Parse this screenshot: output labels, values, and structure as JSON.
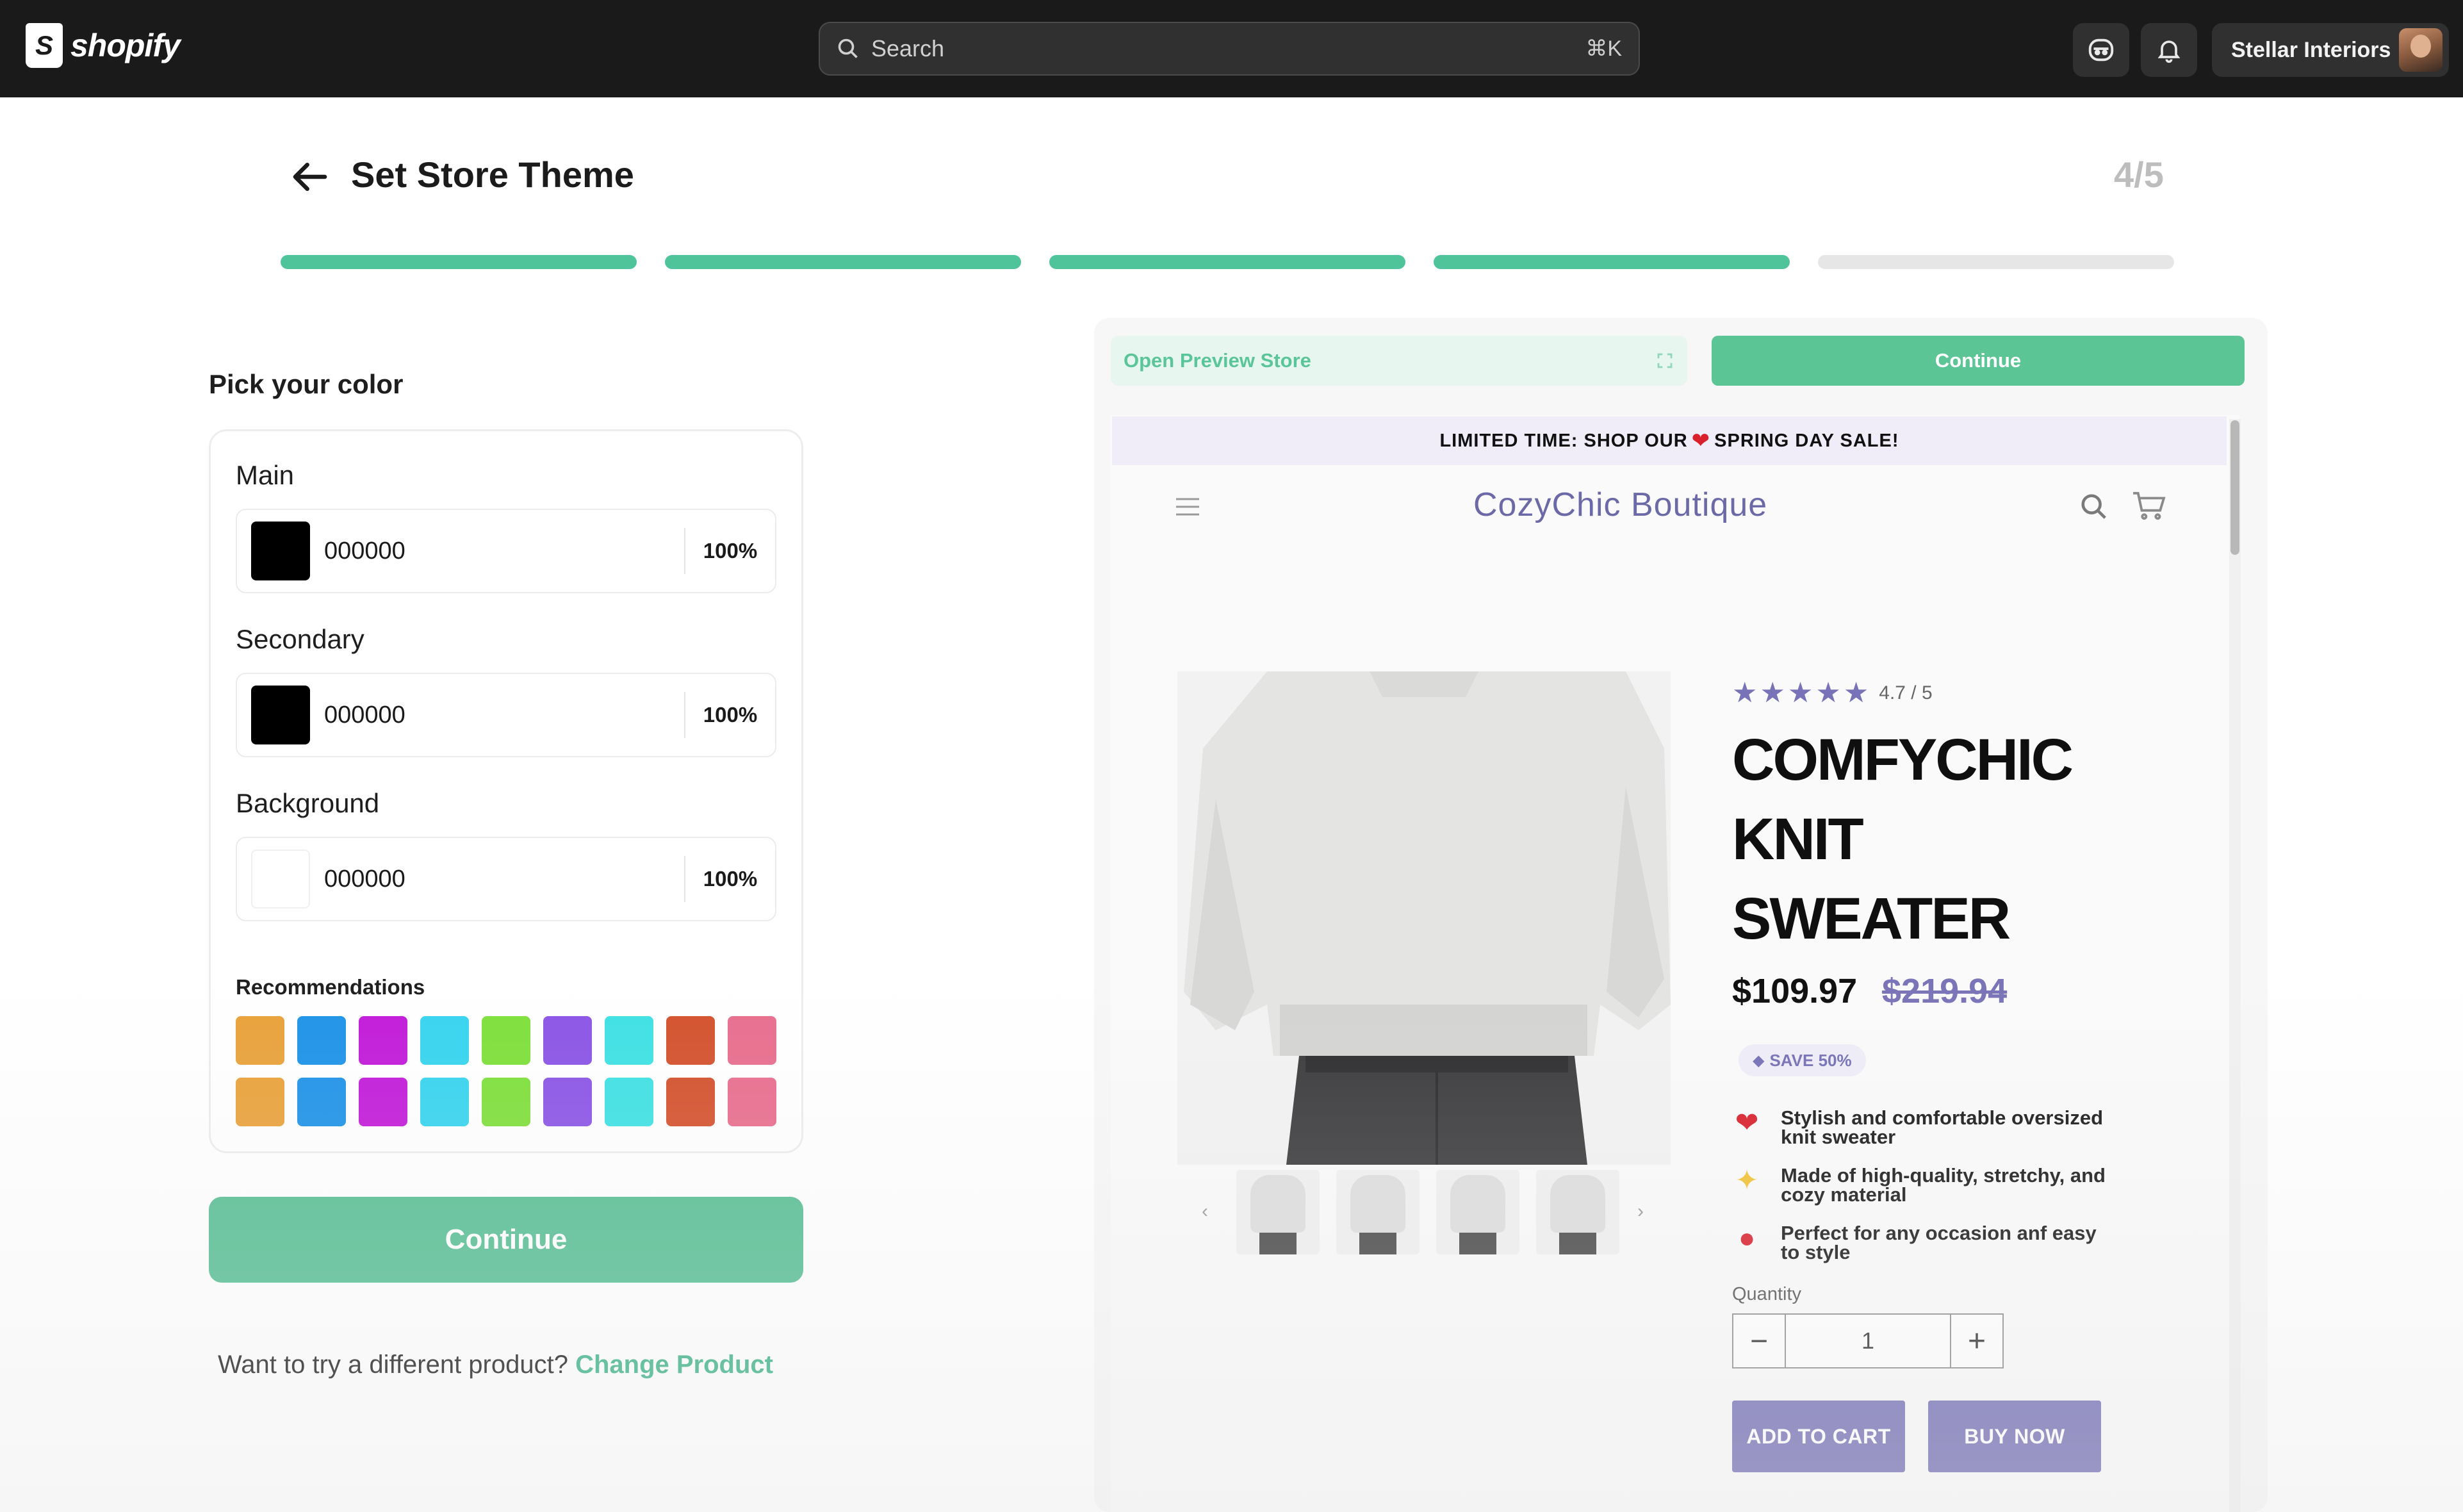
{
  "topbar": {
    "logo_text": "shopify",
    "search_placeholder": "Search",
    "search_shortcut": "⌘K",
    "store_name": "Stellar Interiors",
    "icons": [
      "shopify-bag-icon",
      "search-icon",
      "sidekick-icon",
      "bell-icon",
      "avatar"
    ]
  },
  "header": {
    "title": "Set Store Theme",
    "step": "4/5",
    "progress": {
      "completed": 4,
      "total": 5
    }
  },
  "colors_panel": {
    "title": "Pick your color",
    "fields": [
      {
        "label": "Main",
        "hex": "000000",
        "opacity": "100%",
        "swatch": "#000000"
      },
      {
        "label": "Secondary",
        "hex": "000000",
        "opacity": "100%",
        "swatch": "#000000"
      },
      {
        "label": "Background",
        "hex": "000000",
        "opacity": "100%",
        "swatch": "#ffffff"
      }
    ],
    "recommendations_title": "Recommendations",
    "recommendations": [
      "#e9a23b",
      "#1f93e8",
      "#c21bd9",
      "#37d4ef",
      "#7fe03b",
      "#8b55e6",
      "#3fe1e4",
      "#d4522e",
      "#e86e8e",
      "#e9a23b",
      "#1f93e8",
      "#c21bd9",
      "#37d4ef",
      "#7fe03b",
      "#8b55e6",
      "#3fe1e4",
      "#d4522e",
      "#e86e8e"
    ],
    "continue_label": "Continue",
    "alt_text": "Want to try a different product?",
    "alt_link": "Change Product"
  },
  "preview": {
    "open_preview_label": "Open Preview Store",
    "continue_label": "Continue",
    "promo_left": "LIMITED TIME: SHOP OUR",
    "promo_right": "SPRING DAY SALE!",
    "brand": "CozyChic Boutique",
    "rating": "4.7 / 5",
    "title_lines": [
      "COMFYCHIC",
      "KNIT",
      "SWEATER"
    ],
    "price": "$109.97",
    "old_price": "$219.94",
    "save_badge": "SAVE 50%",
    "features": [
      {
        "icon": "heart-icon",
        "emoji": "❤",
        "color": "#d9202c",
        "text": "Stylish and comfortable oversized knit sweater"
      },
      {
        "icon": "sparkles-icon",
        "emoji": "✨",
        "color": "#f1c232",
        "text": "Made of high-quality, stretchy, and cozy material"
      },
      {
        "icon": "strawberry-icon",
        "emoji": "🍓",
        "color": "#d9202c",
        "text": "Perfect for any occasion anf easy to style"
      }
    ],
    "quantity_label": "Quantity",
    "quantity_value": "1",
    "add_to_cart": "ADD TO CART",
    "buy_now": "BUY NOW",
    "accent_color": "#7570b6"
  },
  "colors": {
    "brand_green": "#58bf94",
    "topbar": "#1a1a1a",
    "progress_done": "#4fc39a",
    "progress_todo": "#e6e6e6"
  }
}
